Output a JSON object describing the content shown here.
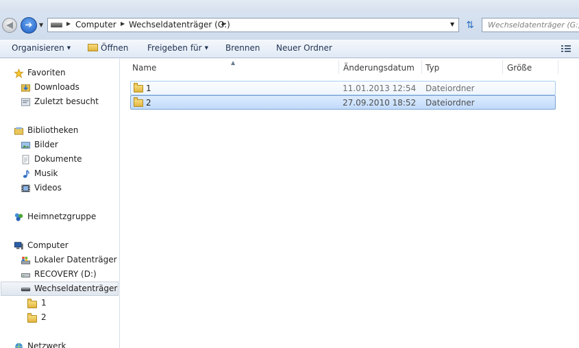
{
  "address": {
    "crumbs": [
      "Computer",
      "Wechseldatenträger (G:)"
    ]
  },
  "search": {
    "placeholder": "Wechseldatenträger (G:) du"
  },
  "toolbar": {
    "organize": "Organisieren",
    "open": "Öffnen",
    "share": "Freigeben für",
    "burn": "Brennen",
    "new_folder": "Neuer Ordner"
  },
  "nav": {
    "favorites": "Favoriten",
    "downloads": "Downloads",
    "recent": "Zuletzt besucht",
    "libraries": "Bibliotheken",
    "pictures": "Bilder",
    "documents": "Dokumente",
    "music": "Musik",
    "videos": "Videos",
    "homegroup": "Heimnetzgruppe",
    "computer": "Computer",
    "local_disk": "Lokaler Datenträger (C:)",
    "recovery": "RECOVERY (D:)",
    "removable": "Wechseldatenträger (G:)",
    "sub1": "1",
    "sub2": "2",
    "network": "Netzwerk"
  },
  "columns": {
    "name": "Name",
    "date": "Änderungsdatum",
    "type": "Typ",
    "size": "Größe"
  },
  "files": [
    {
      "name": "1",
      "date": "11.01.2013 12:54",
      "type": "Dateiordner"
    },
    {
      "name": "2",
      "date": "27.09.2010 18:52",
      "type": "Dateiordner"
    }
  ]
}
